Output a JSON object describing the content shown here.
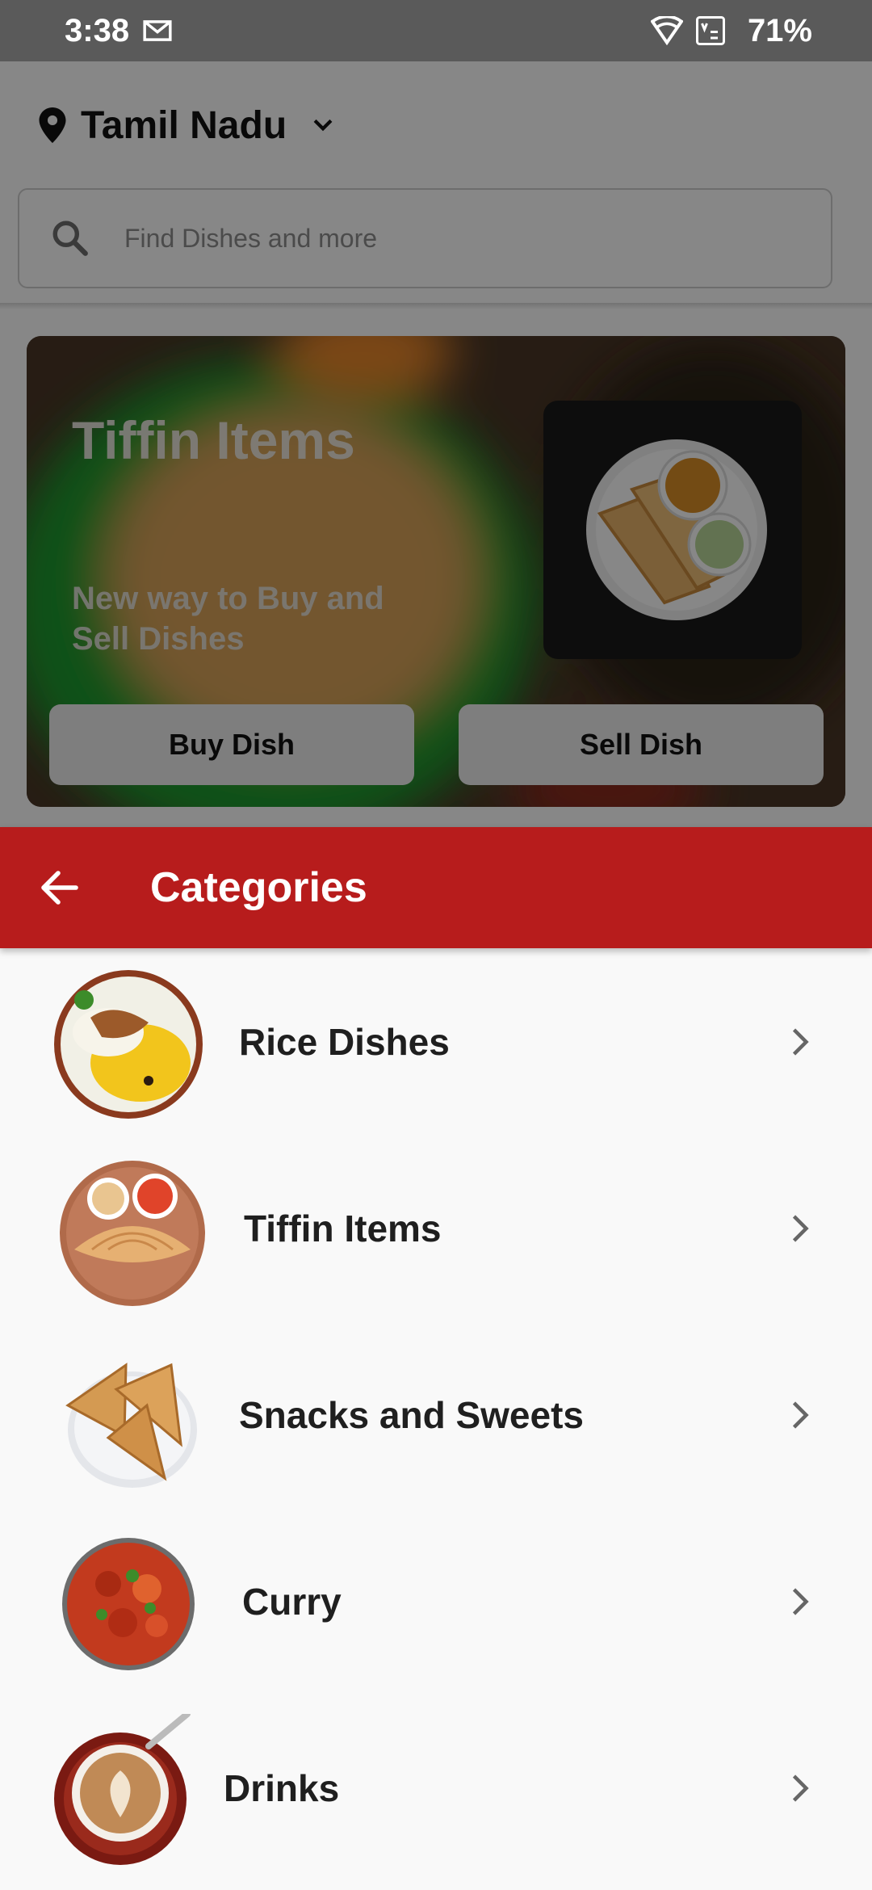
{
  "status_bar": {
    "time": "3:38",
    "battery": "71%"
  },
  "header": {
    "location": "Tamil Nadu",
    "search_placeholder": "Find Dishes and more"
  },
  "banner": {
    "title": "Tiffin Items",
    "subtitle": "New way to Buy and Sell Dishes",
    "buy_label": "Buy Dish",
    "sell_label": "Sell Dish"
  },
  "categories_sheet": {
    "title": "Categories",
    "items": [
      {
        "label": "Rice Dishes",
        "icon": "rice-bowl"
      },
      {
        "label": "Tiffin Items",
        "icon": "dosa-plate"
      },
      {
        "label": "Snacks and Sweets",
        "icon": "samosa-plate"
      },
      {
        "label": "Curry",
        "icon": "curry-bowl"
      },
      {
        "label": "Drinks",
        "icon": "coffee-cup"
      }
    ]
  },
  "colors": {
    "app_bar": "#b71c1c",
    "status_bar": "#5a5a5a",
    "sheet_background": "#f9f9f9"
  }
}
